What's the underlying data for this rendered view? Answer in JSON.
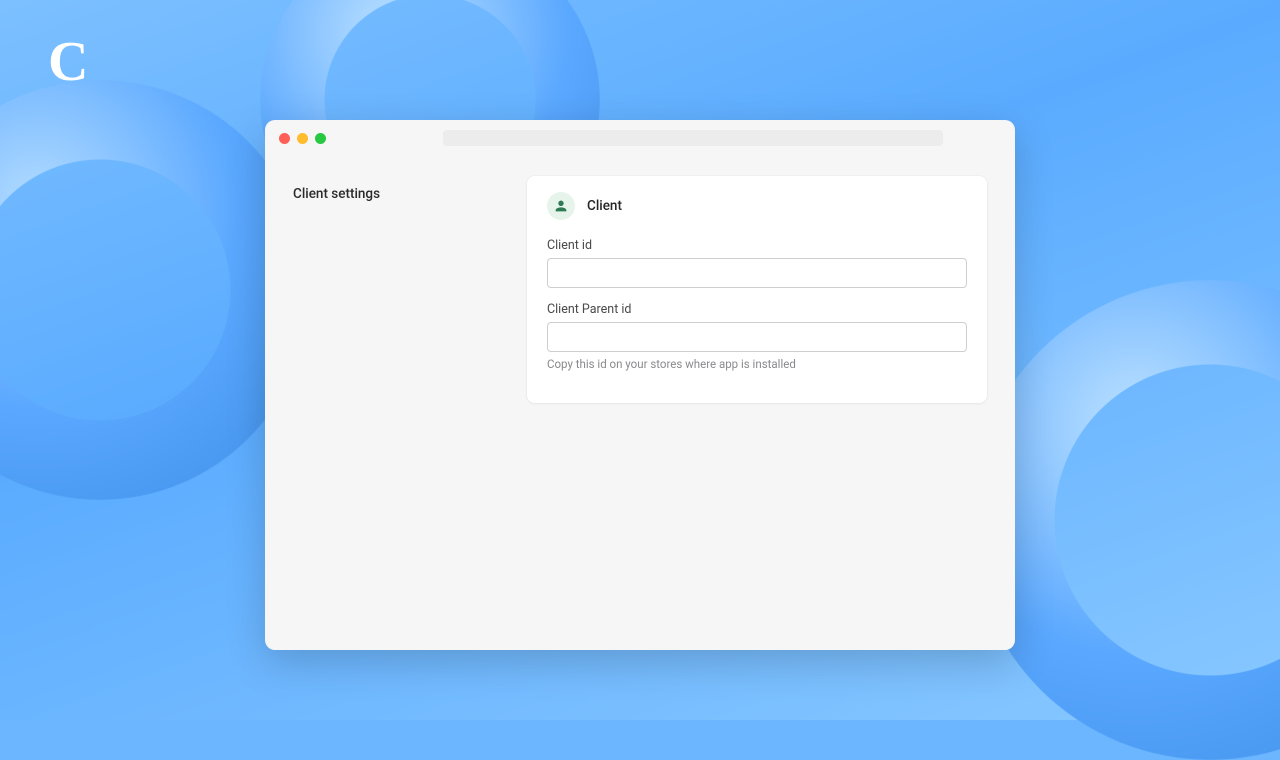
{
  "logo_letter": "C",
  "sidebar": {
    "title": "Client settings"
  },
  "card": {
    "title": "Client",
    "fields": {
      "client_id": {
        "label": "Client id",
        "value": ""
      },
      "client_parent_id": {
        "label": "Client Parent id",
        "value": "",
        "helper": "Copy this id on your stores where app is installed"
      }
    }
  }
}
